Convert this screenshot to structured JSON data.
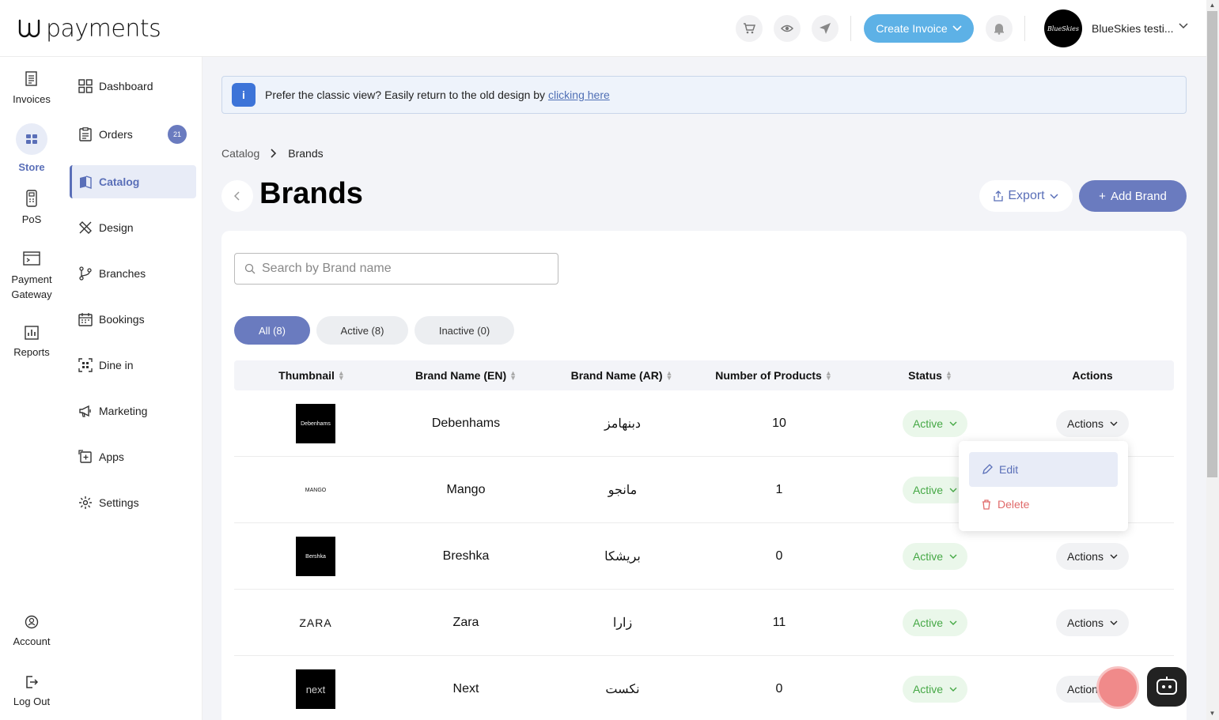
{
  "brand": {
    "logo_text": "payments"
  },
  "header": {
    "create_invoice": "Create Invoice",
    "account_name": "BlueSkies testi...",
    "avatar_text": "BlueSkies"
  },
  "rail": [
    {
      "label": "Invoices"
    },
    {
      "label": "Store"
    },
    {
      "label": "PoS"
    },
    {
      "label": "Payment Gateway"
    },
    {
      "label": "Reports"
    },
    {
      "label": "Account"
    },
    {
      "label": "Log Out"
    }
  ],
  "subnav": [
    {
      "label": "Dashboard"
    },
    {
      "label": "Orders",
      "badge": "21"
    },
    {
      "label": "Catalog"
    },
    {
      "label": "Design"
    },
    {
      "label": "Branches"
    },
    {
      "label": "Bookings"
    },
    {
      "label": "Dine in"
    },
    {
      "label": "Marketing"
    },
    {
      "label": "Apps"
    },
    {
      "label": "Settings"
    }
  ],
  "notice": {
    "text": "Prefer the classic view? Easily return to the old design by",
    "link": "clicking here"
  },
  "breadcrumb": {
    "parent": "Catalog",
    "current": "Brands"
  },
  "page": {
    "title": "Brands",
    "export": "Export",
    "add": "Add Brand"
  },
  "search": {
    "placeholder": "Search by Brand name"
  },
  "filters": [
    {
      "label": "All (8)"
    },
    {
      "label": "Active (8)"
    },
    {
      "label": "Inactive (0)"
    }
  ],
  "table": {
    "headers": [
      "Thumbnail",
      "Brand Name (EN)",
      "Brand Name (AR)",
      "Number of Products",
      "Status",
      "Actions"
    ],
    "rows": [
      {
        "thumb": "Debenhams",
        "en": "Debenhams",
        "ar": "دبنهامز",
        "products": "10",
        "status": "Active",
        "actions": "Actions"
      },
      {
        "thumb": "MANGO",
        "en": "Mango",
        "ar": "مانجو",
        "products": "1",
        "status": "Active",
        "actions": "Actions"
      },
      {
        "thumb": "Bershka",
        "en": "Breshka",
        "ar": "بريشكا",
        "products": "0",
        "status": "Active",
        "actions": "Actions"
      },
      {
        "thumb": "ZARA",
        "en": "Zara",
        "ar": "زارا",
        "products": "11",
        "status": "Active",
        "actions": "Actions"
      },
      {
        "thumb": "next",
        "en": "Next",
        "ar": "نكست",
        "products": "0",
        "status": "Active",
        "actions": "Actions"
      }
    ]
  },
  "dropdown": {
    "edit": "Edit",
    "delete": "Delete"
  }
}
